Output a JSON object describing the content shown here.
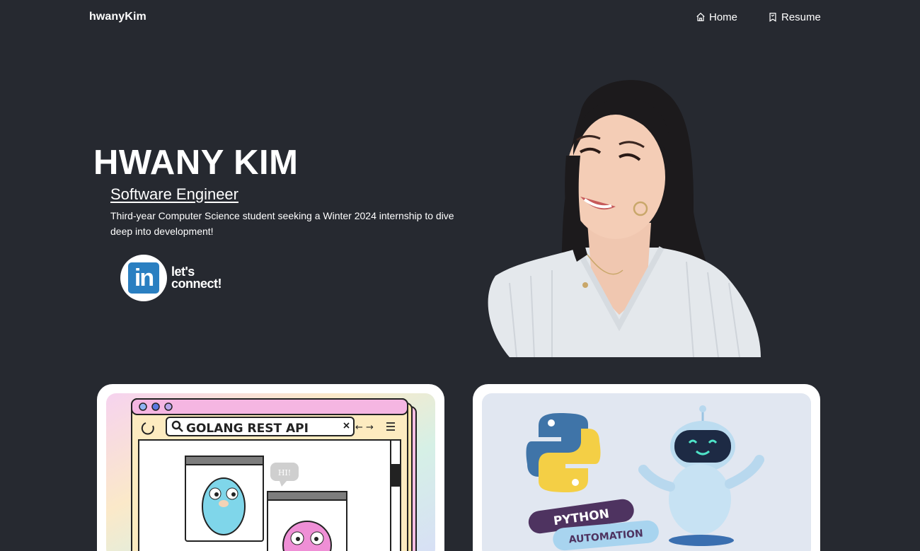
{
  "nav": {
    "brand": "hwanyKim",
    "home_label": "Home",
    "resume_label": "Resume"
  },
  "hero": {
    "name": "HWANY KIM",
    "role": "Software Engineer",
    "blurb": "Third-year Computer Science student seeking a Winter 2024 internship to dive deep into development!",
    "connect_line1": "let's",
    "connect_line2": "connect!",
    "linkedin_logo": "in"
  },
  "projects": [
    {
      "search_text": "GOLANG REST API",
      "bubble_text": "HI!"
    },
    {
      "badge1": "PYTHON",
      "badge2": "AUTOMATION"
    }
  ],
  "colors": {
    "background": "#262930",
    "text": "#ffffff",
    "linkedin": "#2a7fc1",
    "python_badge": "#4e3360",
    "automation_badge": "#a8d4ef"
  },
  "icons": [
    "home-icon",
    "bookmark-icon",
    "linkedin-icon",
    "search-icon",
    "refresh-icon",
    "close-icon",
    "menu-icon"
  ]
}
